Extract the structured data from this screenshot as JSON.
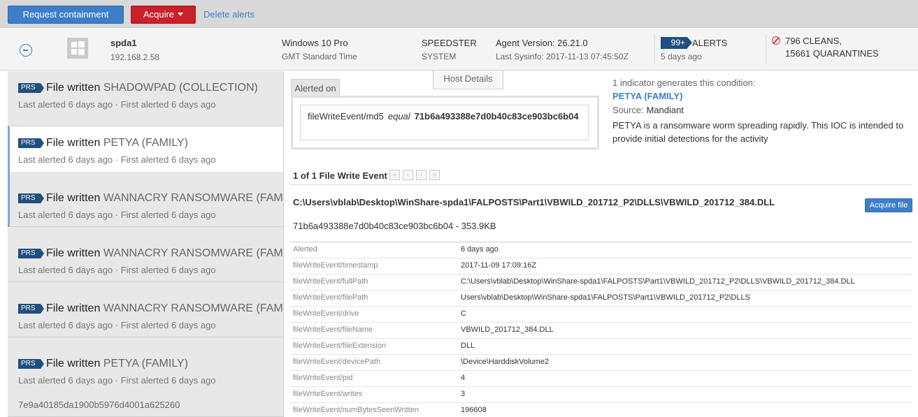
{
  "toolbar": {
    "request_containment": "Request containment",
    "acquire": "Acquire",
    "delete_alerts": "Delete alerts"
  },
  "host": {
    "name": "spda1",
    "ip": "192.168.2.58",
    "os": "Windows 10 Pro",
    "timezone": "GMT Standard Time",
    "domain": "SPEEDSTER",
    "user": "SYSTEM",
    "agent_version": "Agent Version: 26.21.0",
    "last_sysinfo": "Last Sysinfo: 2017-11-13 07:45:50Z",
    "alerts_count": "99+",
    "alerts_label": "ALERTS",
    "alerts_age": "5 days ago",
    "cleans": "796 CLEANS,",
    "quarantines": "15661 QUARANTINES"
  },
  "alert_list": {
    "items": [
      {
        "tag": "PRS",
        "action": "File written",
        "name": "SHADOWPAD (COLLECTION)",
        "sub": "Last alerted 6 days ago · First alerted 6 days ago"
      },
      {
        "tag": "PRS",
        "action": "File written",
        "name": "PETYA (FAMILY)",
        "sub": "Last alerted 6 days ago · First alerted 6 days ago"
      },
      {
        "tag": "PRS",
        "action": "File written",
        "name": "WANNACRY RANSOMWARE (FAMILY)",
        "sub": "Last alerted 6 days ago · First alerted 6 days ago"
      },
      {
        "tag": "PRS",
        "action": "File written",
        "name": "WANNACRY RANSOMWARE (FAMILY)",
        "sub": "Last alerted 6 days ago · First alerted 6 days ago"
      },
      {
        "tag": "PRS",
        "action": "File written",
        "name": "WANNACRY RANSOMWARE (FAMILY)",
        "sub": "Last alerted 6 days ago · First alerted 6 days ago"
      },
      {
        "tag": "PRS",
        "action": "File written",
        "name": "PETYA (FAMILY)",
        "sub": "Last alerted 6 days ago · First alerted 6 days ago"
      }
    ],
    "footer_hash": "7e9a40185da1900b5976d4001a625260"
  },
  "alerted_on": {
    "tab_label": "Alerted on",
    "field": "fileWriteEvent/md5",
    "operator": "equal",
    "value": "71b6a493388e7d0b40c83ce903bc6b04"
  },
  "host_details_tab": "Host Details",
  "indicator": {
    "summary": "1 indicator generates this condition:",
    "name": "PETYA (FAMILY)",
    "source_label": "Source:",
    "source": "Mandiant",
    "description": "PETYA is a ransomware worm spreading rapidly. This IOC is intended to provide initial detections for the activity"
  },
  "event": {
    "count_label": "1 of 1 File Write Event",
    "path": "C:\\Users\\vblab\\Desktop\\WinShare-spda1\\FALPOSTS\\Part1\\VBWILD_201712_P2\\DLLS\\VBWILD_201712_384.DLL",
    "hash_size": "71b6a493388e7d0b40c83ce903bc6b04 - 353.9KB",
    "acquire_file": "Acquire file",
    "properties": [
      {
        "key": "Alerted",
        "value": "6 days ago"
      },
      {
        "key": "fileWriteEvent/timestamp",
        "value": "2017-11-09 17:09:16Z"
      },
      {
        "key": "fileWriteEvent/fullPath",
        "value": "C:\\Users\\vblab\\Desktop\\WinShare-spda1\\FALPOSTS\\Part1\\VBWILD_201712_P2\\DLLS\\VBWILD_201712_384.DLL"
      },
      {
        "key": "fileWriteEvent/filePath",
        "value": "Users\\vblab\\Desktop\\WinShare-spda1\\FALPOSTS\\Part1\\VBWILD_201712_P2\\DLLS"
      },
      {
        "key": "fileWriteEvent/drive",
        "value": "C"
      },
      {
        "key": "fileWriteEvent/fileName",
        "value": "VBWILD_201712_384.DLL"
      },
      {
        "key": "fileWriteEvent/fileExtension",
        "value": "DLL"
      },
      {
        "key": "fileWriteEvent/devicePath",
        "value": "\\Device\\HarddiskVolume2"
      },
      {
        "key": "fileWriteEvent/pid",
        "value": "4"
      },
      {
        "key": "fileWriteEvent/writes",
        "value": "3"
      },
      {
        "key": "fileWriteEvent/numBytesSeenWritten",
        "value": "196608"
      }
    ]
  }
}
